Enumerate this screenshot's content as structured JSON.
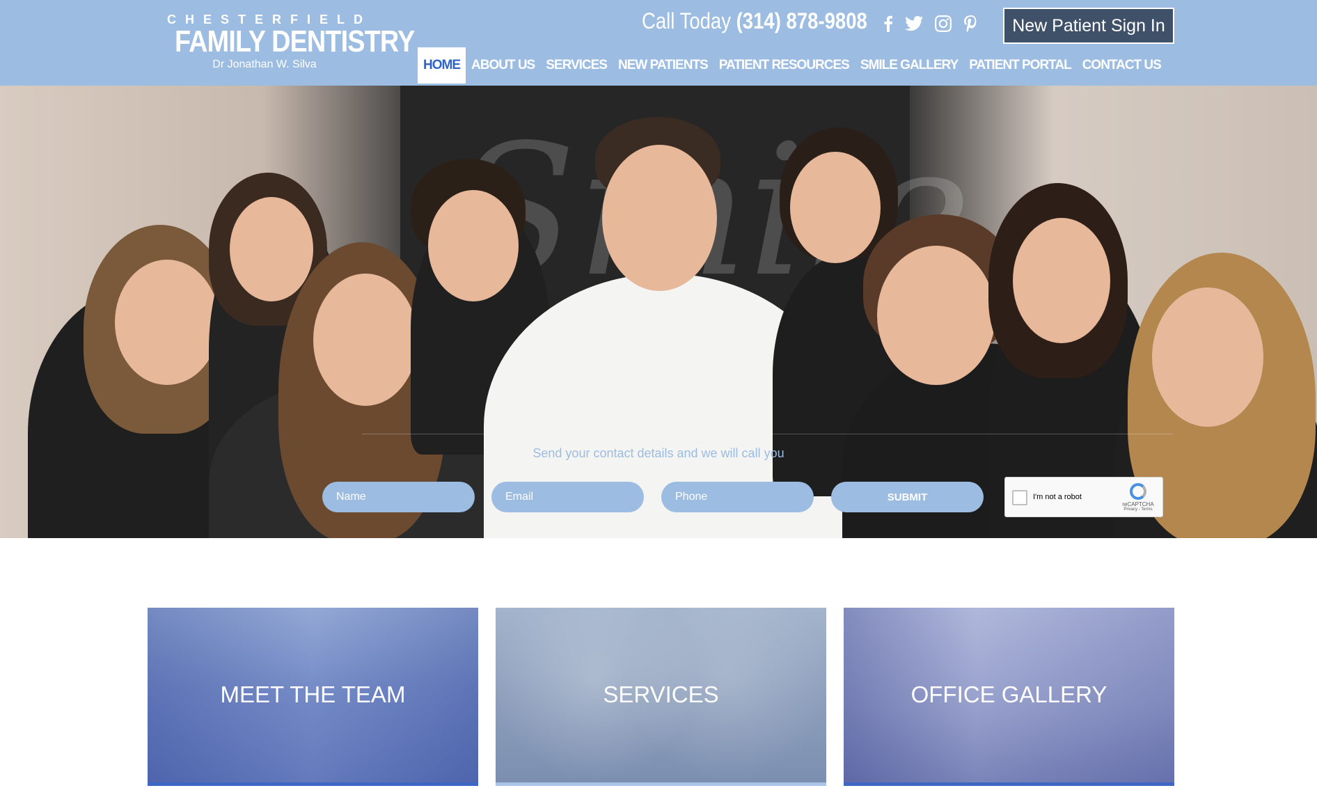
{
  "header": {
    "logo": {
      "top": "CHESTERFIELD",
      "main": "FAMILY DENTISTRY",
      "sub": "Dr Jonathan W. Silva"
    },
    "call_prefix": "Call Today",
    "phone": "(314) 878-9808",
    "social": [
      "facebook-icon",
      "twitter-icon",
      "instagram-icon",
      "pinterest-icon"
    ],
    "signin_label": "New Patient Sign In"
  },
  "nav": {
    "items": [
      {
        "label": "HOME",
        "active": true
      },
      {
        "label": "ABOUT US"
      },
      {
        "label": "SERVICES"
      },
      {
        "label": "NEW PATIENTS"
      },
      {
        "label": "PATIENT RESOURCES"
      },
      {
        "label": "SMILE GALLERY"
      },
      {
        "label": "PATIENT PORTAL"
      },
      {
        "label": "CONTACT US"
      }
    ]
  },
  "hero": {
    "poster_text": "Smile",
    "prompt": "Send your contact details and we will call you",
    "form": {
      "name_placeholder": "Name",
      "email_placeholder": "Email",
      "phone_placeholder": "Phone",
      "submit_label": "SUBMIT"
    },
    "captcha": {
      "label": "I'm not a robot",
      "brand": "reCAPTCHA",
      "terms": "Privacy - Terms"
    }
  },
  "cards": [
    {
      "label": "MEET THE TEAM"
    },
    {
      "label": "SERVICES"
    },
    {
      "label": "OFFICE GALLERY"
    }
  ],
  "colors": {
    "header_bg": "#9cbce2",
    "signin_bg": "#3f5168",
    "nav_active_text": "#2f63c8",
    "card_bar": "#3e67c4"
  }
}
